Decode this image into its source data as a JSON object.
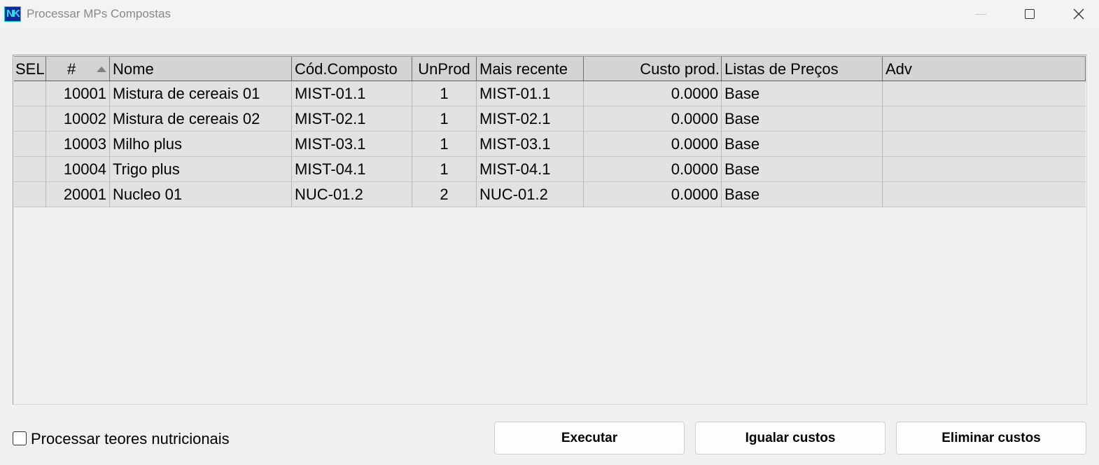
{
  "window": {
    "title": "Processar MPs Compostas",
    "icon_text": "NK"
  },
  "grid": {
    "headers": {
      "sel": "SEL",
      "num": "#",
      "nome": "Nome",
      "cod": "Cód.Composto",
      "unprod": "UnProd",
      "mais": "Mais recente",
      "custo": "Custo prod.",
      "listas": "Listas de Preços",
      "adv": "Adv"
    },
    "sort": {
      "column": "#",
      "direction": "ascending"
    },
    "rows": [
      {
        "sel": "",
        "num": "10001",
        "nome": "Mistura de cereais 01",
        "cod": "MIST-01.1",
        "unprod": "1",
        "mais": "MIST-01.1",
        "custo": "0.0000",
        "listas": "Base",
        "adv": ""
      },
      {
        "sel": "",
        "num": "10002",
        "nome": "Mistura de cereais 02",
        "cod": "MIST-02.1",
        "unprod": "1",
        "mais": "MIST-02.1",
        "custo": "0.0000",
        "listas": "Base",
        "adv": ""
      },
      {
        "sel": "",
        "num": "10003",
        "nome": "Milho plus",
        "cod": "MIST-03.1",
        "unprod": "1",
        "mais": "MIST-03.1",
        "custo": "0.0000",
        "listas": "Base",
        "adv": ""
      },
      {
        "sel": "",
        "num": "10004",
        "nome": "Trigo plus",
        "cod": "MIST-04.1",
        "unprod": "1",
        "mais": "MIST-04.1",
        "custo": "0.0000",
        "listas": "Base",
        "adv": ""
      },
      {
        "sel": "",
        "num": "20001",
        "nome": "Nucleo 01",
        "cod": "NUC-01.2",
        "unprod": "2",
        "mais": "NUC-01.2",
        "custo": "0.0000",
        "listas": "Base",
        "adv": ""
      }
    ]
  },
  "options": {
    "nutri_label": "Processar teores nutricionais",
    "nutri_checked": false
  },
  "buttons": {
    "executar": "Executar",
    "igualar": "Igualar custos",
    "eliminar": "Eliminar custos"
  }
}
